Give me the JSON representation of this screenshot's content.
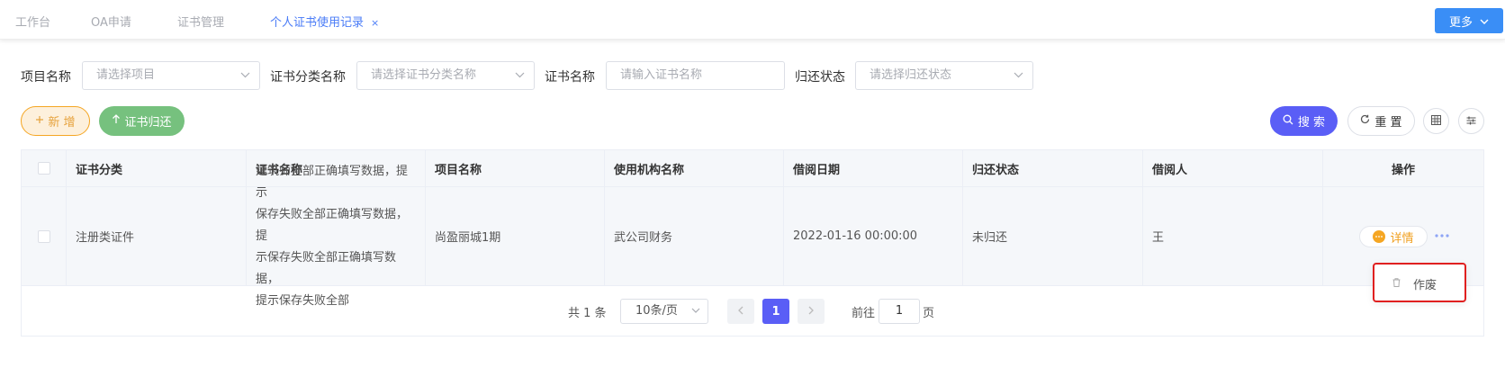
{
  "tabs": [
    {
      "label": "工作台",
      "active": false
    },
    {
      "label": "OA申请",
      "active": false
    },
    {
      "label": "证书管理",
      "active": false
    },
    {
      "label": "个人证书使用记录",
      "active": true,
      "close": "×"
    }
  ],
  "more_button": {
    "label": "更多"
  },
  "filters": [
    {
      "label": "项目名称",
      "placeholder": "请选择项目",
      "type": "select"
    },
    {
      "label": "证书分类名称",
      "placeholder": "请选择证书分类名称",
      "type": "select"
    },
    {
      "label": "证书名称",
      "placeholder": "请输入证书名称",
      "type": "input"
    },
    {
      "label": "归还状态",
      "placeholder": "请选择归还状态",
      "type": "select"
    }
  ],
  "toolbar": {
    "add_label": "新 增",
    "return_label": "证书归还",
    "search_label": "搜 索",
    "reset_label": "重 置"
  },
  "table": {
    "columns": [
      "证书分类",
      "证书名称",
      "项目名称",
      "使用机构名称",
      "借阅日期",
      "归还状态",
      "借阅人",
      "操作"
    ],
    "rows": [
      {
        "category": "注册类证件",
        "cert_name_lines": [
          "建筑师全部正确填写数据，提示",
          "保存失败全部正确填写数据，提",
          "示保存失败全部正确填写数据，",
          "提示保存失败全部"
        ],
        "project": "尚盈丽城1期",
        "org": "武公司财务",
        "borrow_date": "2022-01-16 00:00:00",
        "return_status": "未归还",
        "borrower": "王",
        "detail_label": "详情"
      }
    ]
  },
  "dropdown": {
    "void_label": "作废"
  },
  "pagination": {
    "total_text": "共 1 条",
    "page_size": "10条/页",
    "current_page": "1",
    "goto_label": "前往",
    "goto_value": "1",
    "goto_unit": "页"
  },
  "colors": {
    "primary": "#5a5ef6",
    "tab_active": "#4a7cf7",
    "more_button": "#3a8ef6",
    "add_button": "#e6a23c",
    "return_button": "#76c17e",
    "highlight_border": "#e02020"
  }
}
